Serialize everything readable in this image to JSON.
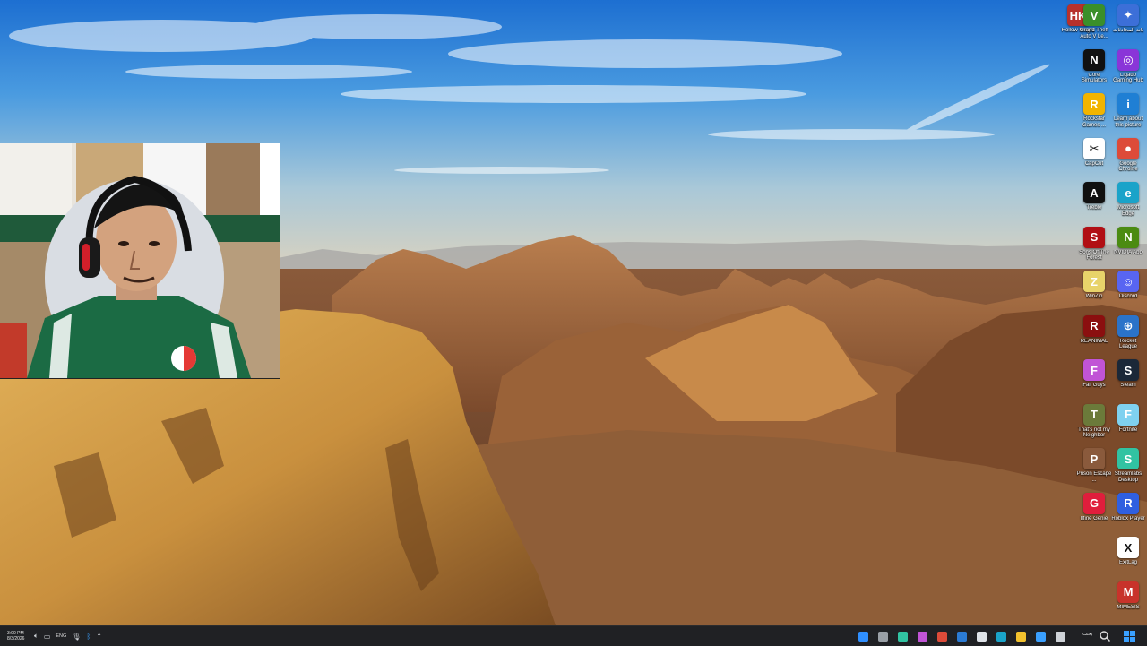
{
  "desktop": {
    "icons": [
      {
        "label": "Hollow Knight",
        "glyph": "HK",
        "color": "#b7312c",
        "icon": "hollow-knight-icon"
      },
      {
        "label": "Grand Theft Auto V Le...",
        "glyph": "V",
        "color": "#3a8f2a",
        "icon": "gta-v-icon"
      },
      {
        "label": "باند المحادثات",
        "glyph": "✦",
        "color": "#3c6fd8",
        "icon": "app-icon"
      },
      {
        "label": "Core Simulators",
        "glyph": "N",
        "color": "#111111",
        "icon": "core-simulators-icon"
      },
      {
        "label": "Ligado Gaming Hub",
        "glyph": "◎",
        "color": "#8a35d8",
        "icon": "gaming-hub-icon"
      },
      {
        "label": "Rockstar Games ...",
        "glyph": "R",
        "color": "#f2b400",
        "icon": "rockstar-icon"
      },
      {
        "label": "Learn about this picture",
        "glyph": "i",
        "color": "#1f7fd4",
        "icon": "learn-picture-icon"
      },
      {
        "label": "CapCut",
        "glyph": "✂",
        "color": "#ffffff",
        "icon": "capcut-icon"
      },
      {
        "label": "Google Chrome",
        "glyph": "●",
        "color": "#dd4b39",
        "icon": "chrome-icon"
      },
      {
        "label": "Treble",
        "glyph": "A",
        "color": "#101010",
        "icon": "treble-icon"
      },
      {
        "label": "Microsoft Edge",
        "glyph": "e",
        "color": "#1aa3c9",
        "icon": "edge-icon"
      },
      {
        "label": "Sons Of The Forest",
        "glyph": "S",
        "color": "#b10f14",
        "icon": "sons-forest-icon"
      },
      {
        "label": "NVIDIA App",
        "glyph": "N",
        "color": "#4b8b12",
        "icon": "nvidia-icon"
      },
      {
        "label": "WinZip",
        "glyph": "Z",
        "color": "#e8d36a",
        "icon": "winzip-icon"
      },
      {
        "label": "Discord",
        "glyph": "☺",
        "color": "#5865f2",
        "icon": "discord-icon"
      },
      {
        "label": "REANIMAL",
        "glyph": "R",
        "color": "#8b0f0f",
        "icon": "reanimal-icon"
      },
      {
        "label": "Rocket League",
        "glyph": "⊕",
        "color": "#2b73c9",
        "icon": "rocket-league-icon"
      },
      {
        "label": "Fall Guys",
        "glyph": "F",
        "color": "#c154d6",
        "icon": "fall-guys-icon"
      },
      {
        "label": "Steam",
        "glyph": "S",
        "color": "#1b2838",
        "icon": "steam-icon"
      },
      {
        "label": "That's not my Neighbor",
        "glyph": "T",
        "color": "#6b7a3a",
        "icon": "neighbor-icon"
      },
      {
        "label": "Fortnite",
        "glyph": "F",
        "color": "#7fd1f0",
        "icon": "fortnite-icon"
      },
      {
        "label": "Prison Escape ...",
        "glyph": "P",
        "color": "#8a5a3c",
        "icon": "prison-escape-icon"
      },
      {
        "label": "Streamlabs Desktop",
        "glyph": "S",
        "color": "#31c3a2",
        "icon": "streamlabs-icon"
      },
      {
        "label": "Ilfine Genie",
        "glyph": "G",
        "color": "#e01e3c",
        "icon": "genie-icon"
      },
      {
        "label": "Roblox Player",
        "glyph": "R",
        "color": "#2f5fe0",
        "icon": "roblox-icon"
      },
      {
        "label": "ExitLag",
        "glyph": "X",
        "color": "#ffffff",
        "icon": "exitlag-icon"
      },
      {
        "label": "MIMESIS",
        "glyph": "M",
        "color": "#c8332b",
        "icon": "mimesis-icon"
      }
    ]
  },
  "taskbar": {
    "time": "3:00 PM",
    "date": "8/3/2026",
    "language": "ENG",
    "search_label": "بحث",
    "apps": [
      {
        "icon": "pen-icon",
        "color": "#2f8fff"
      },
      {
        "icon": "settings-icon",
        "color": "#9aa0a6"
      },
      {
        "icon": "streamlabs-icon",
        "color": "#31c3a2"
      },
      {
        "icon": "app-pink-icon",
        "color": "#c154d6"
      },
      {
        "icon": "chrome-icon",
        "color": "#dd4b39"
      },
      {
        "icon": "vscode-icon",
        "color": "#2b7bd4"
      },
      {
        "icon": "notepad-icon",
        "color": "#dfe3e8"
      },
      {
        "icon": "edge-icon",
        "color": "#1aa3c9"
      },
      {
        "icon": "file-explorer-icon",
        "color": "#f2c12e"
      },
      {
        "icon": "store-icon",
        "color": "#3aa0ff"
      },
      {
        "icon": "task-view-icon",
        "color": "#cfd3d8"
      }
    ]
  }
}
